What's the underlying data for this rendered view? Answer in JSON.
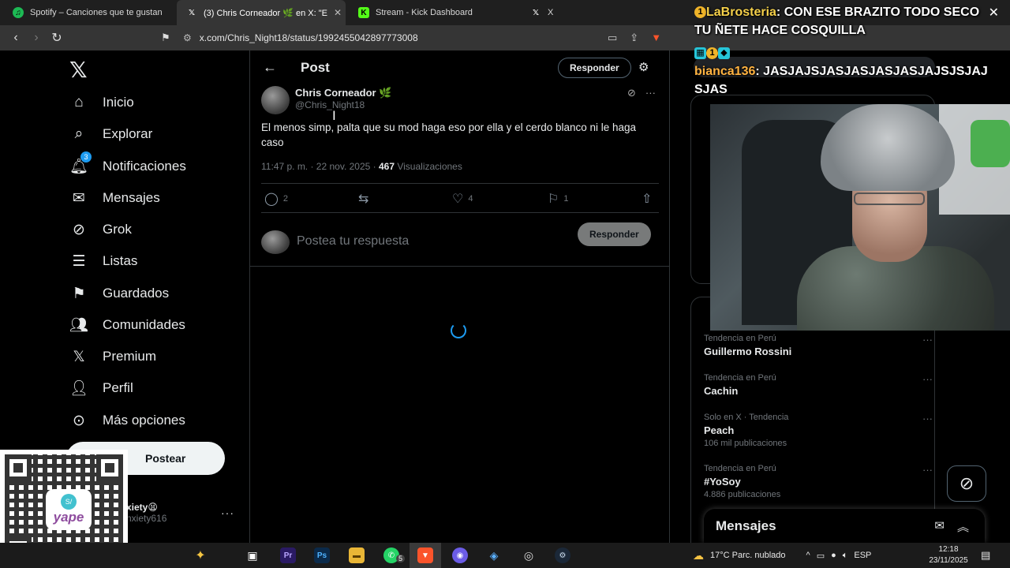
{
  "browser": {
    "tabs": [
      {
        "title": "Spotify – Canciones que te gustan",
        "favicon": "spotify-icon",
        "color": "#1db954"
      },
      {
        "title": "(3) Chris Corneador 🌿 en X: \"E",
        "favicon": "x-icon",
        "color": "#ffffff"
      },
      {
        "title": "Stream - Kick Dashboard",
        "favicon": "kick-icon",
        "color": "#53fc18"
      },
      {
        "title": "X",
        "favicon": "x-icon",
        "color": "#ffffff"
      }
    ],
    "url": "x.com/Chris_Night18/status/1992455042897773008"
  },
  "sidebar": {
    "items": [
      {
        "label": "Inicio",
        "icon": "home-icon",
        "glyph": "⌂"
      },
      {
        "label": "Explorar",
        "icon": "search-icon",
        "glyph": "⌕"
      },
      {
        "label": "Notificaciones",
        "icon": "bell-icon",
        "glyph": "🔔︎",
        "badge": "3"
      },
      {
        "label": "Mensajes",
        "icon": "mail-icon",
        "glyph": "✉"
      },
      {
        "label": "Grok",
        "icon": "grok-icon",
        "glyph": "⊘"
      },
      {
        "label": "Listas",
        "icon": "list-icon",
        "glyph": "☰"
      },
      {
        "label": "Guardados",
        "icon": "bookmark-icon",
        "glyph": "⚑"
      },
      {
        "label": "Comunidades",
        "icon": "communities-icon",
        "glyph": "👥︎"
      },
      {
        "label": "Premium",
        "icon": "x-premium-icon",
        "glyph": "𝕏"
      },
      {
        "label": "Perfil",
        "icon": "person-icon",
        "glyph": "👤︎"
      },
      {
        "label": "Más opciones",
        "icon": "more-circle-icon",
        "glyph": "⊙"
      }
    ],
    "post_label": "Postear",
    "account": {
      "name": "xiety😫",
      "handle": "nxiety616"
    }
  },
  "main": {
    "header_title": "Post",
    "header_reply": "Responder",
    "tweet": {
      "author": "Chris Corneador 🌿",
      "handle": "@Chris_Night18",
      "text": "El menos simp, palta que su mod haga eso por ella y el cerdo blanco ni le haga caso",
      "time": "11:47 p. m. · 22 nov. 2025 · ",
      "views_count": "467",
      "views_label": " Visualizaciones",
      "actions": {
        "replies": "2",
        "reposts": "",
        "likes": "4",
        "bookmarks": "1"
      }
    },
    "reply_placeholder": "Postea tu respuesta",
    "reply_button": "Responder"
  },
  "right": {
    "trends": [
      {
        "context": "Tendencia en Perú",
        "title": "Guillermo Rossini",
        "count": ""
      },
      {
        "context": "Tendencia en Perú",
        "title": "Cachin",
        "count": ""
      },
      {
        "context": "Solo en X · Tendencia",
        "title": "Peach",
        "count": "106 mil publicaciones"
      },
      {
        "context": "Tendencia en Perú",
        "title": "#YoSoy",
        "count": "4.886 publicaciones"
      }
    ],
    "messages_label": "Mensajes"
  },
  "overlay": {
    "chat": [
      {
        "user": "LaBrosteria",
        "sep": ": ",
        "message": "CON ESE BRAZITO TODO SECO TU ÑETE HACE COSQUILLA"
      },
      {
        "user": "bianca136",
        "sep": ": ",
        "message": "JASJAJSJASJASJASJASJAJSJSJAJSJAS"
      }
    ],
    "qr_brand": "yape"
  },
  "taskbar": {
    "weather": "17°C  Parc. nublado",
    "lang": "ESP",
    "time": "12:18",
    "date": "23/11/2025",
    "whatsapp_badge": "5"
  }
}
